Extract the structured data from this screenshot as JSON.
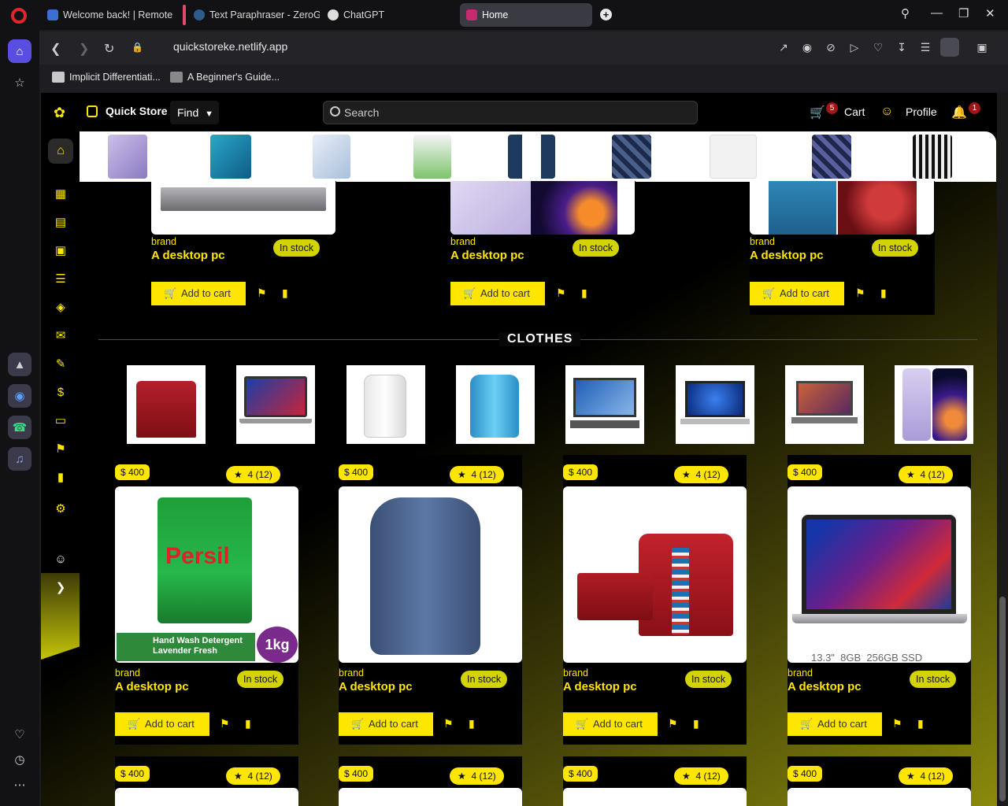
{
  "browser": {
    "tabs": [
      {
        "label": "Welcome back! | Remote"
      },
      {
        "label": "Text Paraphraser - ZeroGP"
      },
      {
        "label": "ChatGPT"
      },
      {
        "label": "Home"
      }
    ],
    "url": "quickstoreke.netlify.app",
    "bookmarks": [
      {
        "label": "Implicit Differentiati..."
      },
      {
        "label": "A Beginner's Guide..."
      }
    ]
  },
  "header": {
    "brand": "Quick Store",
    "find_label": "Find",
    "search_placeholder": "Search",
    "cart_label": "Cart",
    "cart_count": "5",
    "profile_label": "Profile",
    "notif_count": "1"
  },
  "carousel": {
    "items": [
      "phone-purple",
      "phone-blue",
      "phone-silver",
      "detergent-bottle",
      "shirt-blue-stripe",
      "shirt-plaid",
      "shirt-white",
      "shirt-plaid-2",
      "shirt-black-stripe"
    ]
  },
  "top_products": [
    {
      "brand": "brand",
      "name": "A desktop pc",
      "stock": "In stock",
      "add": "Add to cart",
      "image": "laptop-grey"
    },
    {
      "brand": "brand",
      "name": "A desktop pc",
      "stock": "In stock",
      "add": "Add to cart",
      "image": "phone-lilac"
    },
    {
      "brand": "brand",
      "name": "A desktop pc",
      "stock": "In stock",
      "add": "Add to cart",
      "image": "phone-samsung-blue"
    }
  ],
  "clothes_section": {
    "title": "CLOTHES",
    "thumbnails": [
      "handbag-red",
      "macbook",
      "kettle-white",
      "kettle-blue",
      "laptop-yoga",
      "laptop-hp",
      "laptop-asus",
      "phone-purple"
    ]
  },
  "products": [
    {
      "price": "$ 400",
      "rating": "4 (12)",
      "brand": "brand",
      "name": "A desktop pc",
      "stock": "In stock",
      "add": "Add to cart",
      "image": "persil-detergent",
      "img_caption": "Hand Wash Detergent Lavender Fresh",
      "img_weight": "1kg",
      "img_logo": "Persil"
    },
    {
      "price": "$ 400",
      "rating": "4 (12)",
      "brand": "brand",
      "name": "A desktop pc",
      "stock": "In stock",
      "add": "Add to cart",
      "image": "backpack-blue"
    },
    {
      "price": "$ 400",
      "rating": "4 (12)",
      "brand": "brand",
      "name": "A desktop pc",
      "stock": "In stock",
      "add": "Add to cart",
      "image": "handbag-set-red"
    },
    {
      "price": "$ 400",
      "rating": "4 (12)",
      "brand": "brand",
      "name": "A desktop pc",
      "stock": "In stock",
      "add": "Add to cart",
      "image": "macbook-pro",
      "img_caption": "13.3\"  8GB  256GB SSD"
    }
  ],
  "next_row": [
    {
      "price": "$ 400",
      "rating": "4 (12)"
    },
    {
      "price": "$ 400",
      "rating": "4 (12)"
    },
    {
      "price": "$ 400",
      "rating": "4 (12)"
    },
    {
      "price": "$ 400",
      "rating": "4 (12)"
    }
  ],
  "colors": {
    "accent": "#ffe600",
    "background": "#000000",
    "badge": "#a01515"
  }
}
